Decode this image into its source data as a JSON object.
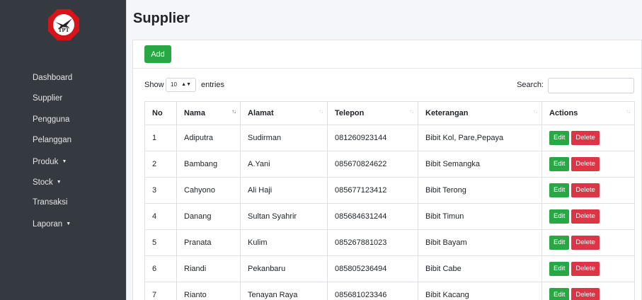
{
  "sidebar": {
    "logo_text": "TPT",
    "items": [
      {
        "label": "Dashboard",
        "caret": false
      },
      {
        "label": "Supplier",
        "caret": false
      },
      {
        "label": "Pengguna",
        "caret": false
      },
      {
        "label": "Pelanggan",
        "caret": false
      },
      {
        "label": "Produk",
        "caret": true
      },
      {
        "label": "Stock",
        "caret": true
      },
      {
        "label": "Transaksi",
        "caret": false
      },
      {
        "label": "Laporan",
        "caret": true
      }
    ]
  },
  "page": {
    "title": "Supplier",
    "add_label": "Add"
  },
  "table_controls": {
    "show_label": "Show",
    "entries_value": "10",
    "entries_label": "entries",
    "search_label": "Search:",
    "search_value": ""
  },
  "table": {
    "headers": [
      "No",
      "Nama",
      "Alamat",
      "Telepon",
      "Keterangan",
      "Actions"
    ],
    "rows": [
      [
        "1",
        "Adiputra",
        "Sudirman",
        "081260923144",
        "Bibit Kol, Pare,Pepaya"
      ],
      [
        "2",
        "Bambang",
        "A.Yani",
        "085670824622",
        "Bibit Semangka"
      ],
      [
        "3",
        "Cahyono",
        "Ali Haji",
        "085677123412",
        "Bibit Terong"
      ],
      [
        "4",
        "Danang",
        "Sultan Syahrir",
        "085684631244",
        "Bibit Timun"
      ],
      [
        "5",
        "Pranata",
        "Kulim",
        "085267881023",
        "Bibit Bayam"
      ],
      [
        "6",
        "Riandi",
        "Pekanbaru",
        "085805236494",
        "Bibit Cabe"
      ],
      [
        "7",
        "Rianto",
        "Tenayan Raya",
        "085681023346",
        "Bibit Kacang"
      ]
    ],
    "edit_label": "Edit",
    "delete_label": "Delete"
  },
  "colors": {
    "sidebar": "#343a40",
    "success": "#28a745",
    "danger": "#dc3545",
    "logo_red": "#d7141a"
  }
}
